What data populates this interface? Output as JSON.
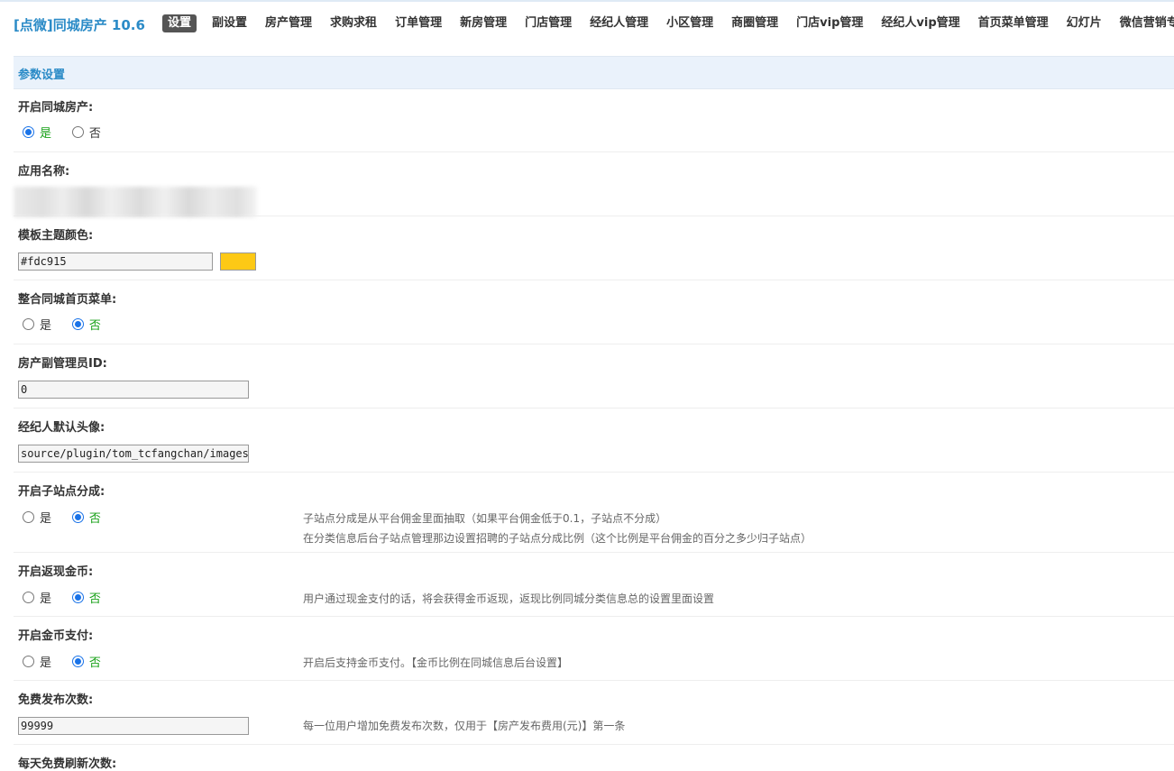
{
  "header": {
    "app_title": "[点微]同城房产 10.6",
    "nav": [
      "设置",
      "副设置",
      "房产管理",
      "求购求租",
      "订单管理",
      "新房管理",
      "门店管理",
      "经纪人管理",
      "小区管理",
      "商圈管理",
      "门店vip管理",
      "经纪人vip管理",
      "首页菜单管理",
      "幻灯片",
      "微信营销专区"
    ],
    "active_nav": "设置"
  },
  "section": {
    "title": "参数设置"
  },
  "rows": {
    "enable": {
      "label": "开启同城房产:",
      "yes": "是",
      "no": "否",
      "selected": "yes"
    },
    "app_name": {
      "label": "应用名称:"
    },
    "theme_color": {
      "label": "模板主题颜色:",
      "value": "#fdc915",
      "swatch": "#fdc915"
    },
    "merge_menu": {
      "label": "整合同城首页菜单:",
      "yes": "是",
      "no": "否",
      "selected": "no"
    },
    "sub_admin": {
      "label": "房产副管理员ID:",
      "value": "0"
    },
    "default_avatar": {
      "label": "经纪人默认头像:",
      "value": "source/plugin/tom_tcfangchan/images/default"
    },
    "substation": {
      "label": "开启子站点分成:",
      "yes": "是",
      "no": "否",
      "selected": "no",
      "help1": "子站点分成是从平台佣金里面抽取（如果平台佣金低于0.1，子站点不分成）",
      "help2": "在分类信息后台子站点管理那边设置招聘的子站点分成比例（这个比例是平台佣金的百分之多少归子站点）"
    },
    "cashback": {
      "label": "开启返现金币:",
      "yes": "是",
      "no": "否",
      "selected": "no",
      "help": "用户通过现金支付的话，将会获得金币返现，返现比例同城分类信息总的设置里面设置"
    },
    "gold_pay": {
      "label": "开启金币支付:",
      "yes": "是",
      "no": "否",
      "selected": "no",
      "help": "开启后支持金币支付。【金币比例在同城信息后台设置】"
    },
    "free_publish": {
      "label": "免费发布次数:",
      "value": "99999",
      "help": "每一位用户增加免费发布次数，仅用于【房产发布费用(元)】第一条"
    },
    "free_refresh": {
      "label": "每天免费刷新次数:"
    }
  }
}
